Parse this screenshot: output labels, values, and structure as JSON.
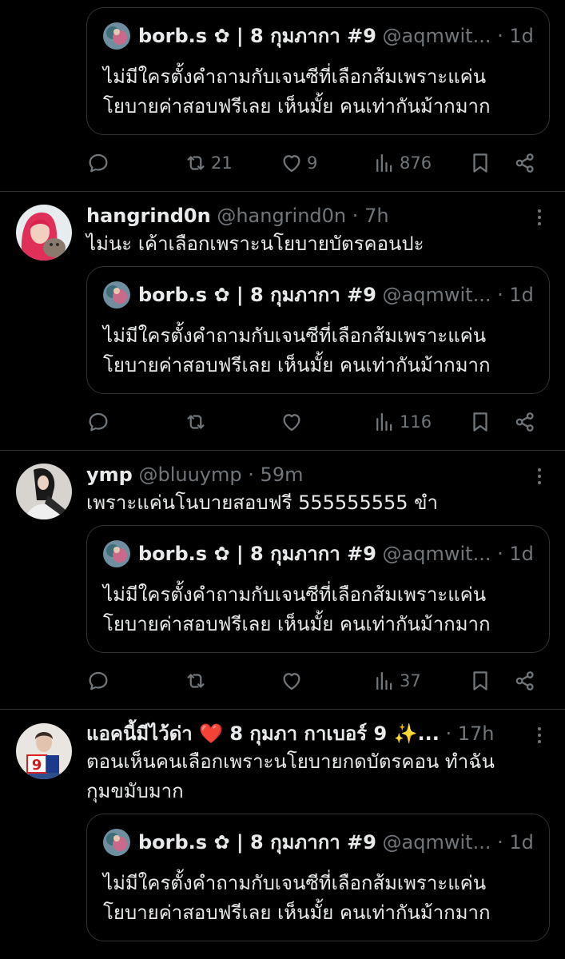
{
  "quoted": {
    "name": "borb.s ✿ | 8 กุมภากา #9",
    "handle": "@aqmwit...",
    "dot": "·",
    "time": "1d",
    "line1": "ไม่มีใครตั้งคำถามกับเจนซีที่เลือกส้มเพราะแค่น",
    "line2": "โยบายค่าสอบฟรีเลย เห็นมั้ย คนเท่ากันม้ากมาก"
  },
  "posts": [
    {
      "replies": "",
      "reposts": "21",
      "likes": "9",
      "views": "876"
    },
    {
      "name": "hangrind0n",
      "handle": "@hangrind0n",
      "dot": "·",
      "time": "7h",
      "line1": "ไม่นะ เค้าเลือกเพราะนโยบายบัตรคอนปะ",
      "replies": "",
      "reposts": "",
      "likes": "",
      "views": "116"
    },
    {
      "name": "ymp",
      "handle": "@bluuymp",
      "dot": "·",
      "time": "59m",
      "line1": "เพราะแค่นโนบายสอบฟรี 555555555 ขำ",
      "replies": "",
      "reposts": "",
      "likes": "",
      "views": "37"
    },
    {
      "name": "แอคนี้มีไว้ด่า ❤️ 8 กุมภา กาเบอร์ 9 ✨...",
      "handle": "",
      "dot": "·",
      "time": "17h",
      "line1": "ตอนเห็นคนเลือกเพราะนโยบายกดบัตรคอน ทำฉัน",
      "line2": "กุมขมับมาก",
      "avatar_badge": "9"
    }
  ],
  "icons": {
    "reply": "reply-icon",
    "repost": "repost-icon",
    "like": "heart-icon",
    "views": "views-icon",
    "bookmark": "bookmark-icon",
    "share": "share-icon",
    "more": "more-icon"
  },
  "colors": {
    "background": "#000000",
    "text": "#e7e9ea",
    "muted": "#71767b",
    "border": "#2f3336"
  }
}
